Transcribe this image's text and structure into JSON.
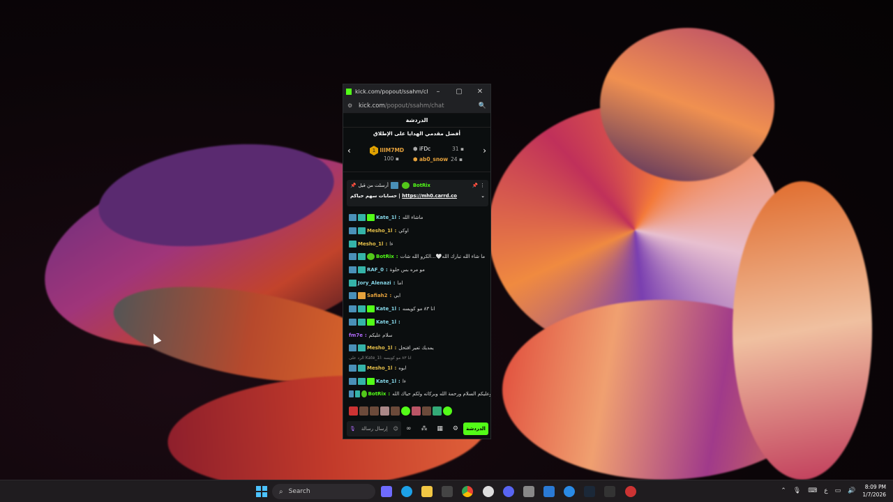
{
  "window": {
    "title": "kick.com/popout/ssahm/ch...",
    "minimize": "–",
    "maximize": "▢",
    "close": "✕"
  },
  "urlbar": {
    "domain": "kick.com",
    "path": "/popout/ssahm/chat"
  },
  "chat": {
    "header": "الدردشة",
    "gifters_title": "أفضل مقدمي الهدايا على الإطلاق",
    "gifters": [
      {
        "rank": "1",
        "name": "IIIM7MD",
        "count": "100"
      },
      {
        "name": "iFDc",
        "count": "31"
      },
      {
        "name": "ab0_snow",
        "count": "24"
      }
    ],
    "pinned": {
      "sender": "BotRix",
      "sent_by_label": "أرسلت من قبل",
      "text": "حسابات سهم حياكم |",
      "link": "https://mh0.carrd.co"
    },
    "messages": [
      {
        "user": "Kate_1l",
        "color": "#86d7e8",
        "text": "ماشاء الله",
        "badges": [
          "k",
          "g",
          "s"
        ]
      },
      {
        "user": "Mesho_1l",
        "color": "#e6c04a",
        "text": "اوكي",
        "badges": [
          "k",
          "g"
        ]
      },
      {
        "user": "Mesho_1l",
        "color": "#e6c04a",
        "text": "ءا",
        "badges": [
          "g"
        ]
      },
      {
        "user": "BotRix",
        "color": "#53fc18",
        "text": "ما شاء الله تبارك الله🤍...الكرو الله شات",
        "badges": [
          "k",
          "g",
          "v"
        ]
      },
      {
        "user": "RAF_0",
        "color": "#86d7e8",
        "text": "مو مره بس حلوة",
        "badges": [
          "k",
          "g"
        ]
      },
      {
        "user": "Jory_Alenazi",
        "color": "#86d7e8",
        "text": "اما",
        "badges": [
          "g"
        ]
      },
      {
        "user": "Safiah2",
        "color": "#e6a23c",
        "text": "ابي",
        "badges": [
          "k",
          "c"
        ]
      },
      {
        "user": "Kate_1l",
        "color": "#86d7e8",
        "text": "انا ٨٣ مو كويسه",
        "badges": [
          "k",
          "g",
          "s"
        ]
      },
      {
        "user": "Kate_1l",
        "color": "#86d7e8",
        "text": "",
        "badges": [
          "k",
          "g",
          "s"
        ]
      },
      {
        "user": "fm7e",
        "color": "#b36cff",
        "text": "سلام عليكم",
        "badges": []
      },
      {
        "user": "Mesho_1l",
        "color": "#e6c04a",
        "text": "يمديك تعير افتحل",
        "badges": [
          "k",
          "g"
        ]
      },
      {
        "user": "Mesho_1l",
        "color": "#e6c04a",
        "text": "ابوه",
        "badges": [
          "k",
          "g"
        ],
        "reply": "الرد على Kate_1l: انا ٨٣ مو كويسه"
      },
      {
        "user": "Kate_1l",
        "color": "#86d7e8",
        "text": "ءا",
        "badges": [
          "k",
          "g",
          "s"
        ]
      },
      {
        "user": "BotRix",
        "color": "#53fc18",
        "text": "وعليكم السلام ورحمة الله وبركاته ولكم حياك الله",
        "badges": [
          "k",
          "g",
          "v"
        ]
      }
    ],
    "input_placeholder": "إرسال رسالة",
    "send_button": "الدردشة"
  },
  "taskbar": {
    "search_label": "Search",
    "time": "8:09 PM",
    "date": "1/7/2026",
    "lang": "ع"
  }
}
